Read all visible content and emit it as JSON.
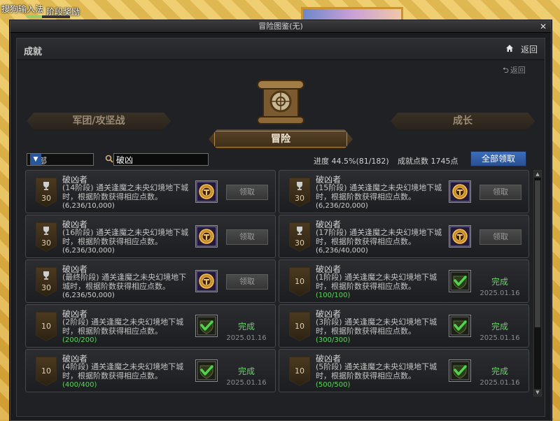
{
  "ime_text": "搜狗输入法",
  "top_stage_reward": "阶段奖励",
  "window": {
    "title": "冒险图鉴(无)",
    "section_title": "成就",
    "back_label": "返回",
    "back_small_label": "返回"
  },
  "tabs": {
    "left": "军团/攻坚战",
    "right": "成长",
    "active": "冒险"
  },
  "filter": {
    "category": "全部",
    "search_value": "破凶"
  },
  "stats": {
    "progress": "进度 44.5%(81/182)",
    "points": "成就点数 1745点",
    "claim_all": "全部领取"
  },
  "achievements": [
    {
      "title": "破凶者",
      "desc": "(14阶段) 通关逢魔之未央幻境地下城时，根据阶数获得相应点数。",
      "progress": "(6,236/10,000)",
      "points": "30",
      "trophy": true,
      "status": "claim",
      "claim_label": "领取"
    },
    {
      "title": "破凶者",
      "desc": "(15阶段) 通关逢魔之未央幻境地下城时，根据阶数获得相应点数。",
      "progress": "(6,236/20,000)",
      "points": "30",
      "trophy": true,
      "status": "claim",
      "claim_label": "领取"
    },
    {
      "title": "破凶者",
      "desc": "(16阶段) 通关逢魔之未央幻境地下城时，根据阶数获得相应点数。",
      "progress": "(6,236/30,000)",
      "points": "30",
      "trophy": true,
      "status": "claim",
      "claim_label": "领取"
    },
    {
      "title": "破凶者",
      "desc": "(17阶段) 通关逢魔之未央幻境地下城时，根据阶数获得相应点数。",
      "progress": "(6,236/40,000)",
      "points": "30",
      "trophy": true,
      "status": "claim",
      "claim_label": "领取"
    },
    {
      "title": "破凶者",
      "desc": "(最终阶段) 通关逢魔之未央幻境地下城时，根据阶数获得相应点数。",
      "progress": "(6,236/50,000)",
      "points": "30",
      "trophy": true,
      "status": "claim",
      "claim_label": "领取"
    },
    {
      "title": "破凶者",
      "desc": "(1阶段) 通关逢魔之未央幻境地下城时，根据阶数获得相应点数。",
      "progress": "(100/100)",
      "points": "10",
      "trophy": false,
      "status": "done",
      "done_label": "完成",
      "done_date": "2025.01.16"
    },
    {
      "title": "破凶者",
      "desc": "(2阶段) 通关逢魔之未央幻境地下城时，根据阶数获得相应点数。",
      "progress": "(200/200)",
      "points": "10",
      "trophy": false,
      "status": "done",
      "done_label": "完成",
      "done_date": "2025.01.16"
    },
    {
      "title": "破凶者",
      "desc": "(3阶段) 通关逢魔之未央幻境地下城时，根据阶数获得相应点数。",
      "progress": "(300/300)",
      "points": "10",
      "trophy": false,
      "status": "done",
      "done_label": "完成",
      "done_date": "2025.01.16"
    },
    {
      "title": "破凶者",
      "desc": "(4阶段) 通关逢魔之未央幻境地下城时，根据阶数获得相应点数。",
      "progress": "(400/400)",
      "points": "10",
      "trophy": false,
      "status": "done",
      "done_label": "完成",
      "done_date": "2025.01.16"
    },
    {
      "title": "破凶者",
      "desc": "(5阶段) 通关逢魔之未央幻境地下城时，根据阶数获得相应点数。",
      "progress": "(500/500)",
      "points": "10",
      "trophy": false,
      "status": "done",
      "done_label": "完成",
      "done_date": "2025.01.16"
    }
  ],
  "icons": {
    "reward": "achievement-medal-icon",
    "done": "green-check-icon",
    "trophy": "trophy-icon",
    "search": "search-icon",
    "home": "home-icon",
    "emblem": "scroll-compass-emblem"
  },
  "colors": {
    "accent_blue": "#2a4f91",
    "done_green": "#6bd26b",
    "tab_gold": "#b48a4c"
  }
}
